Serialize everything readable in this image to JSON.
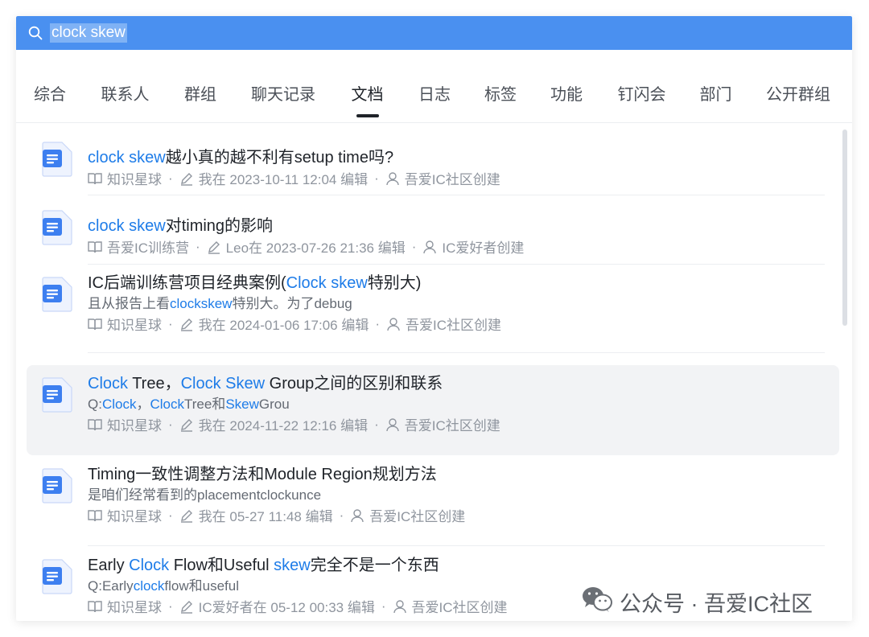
{
  "search": {
    "query": "clock skew"
  },
  "tabs": [
    "综合",
    "联系人",
    "群组",
    "聊天记录",
    "文档",
    "日志",
    "标签",
    "功能",
    "钉闪会",
    "部门",
    "公开群组"
  ],
  "active_tab": "文档",
  "results": [
    {
      "title_parts": [
        [
          "hl",
          "clock skew"
        ],
        [
          "t",
          "越小真的越不利有setup time吗?"
        ]
      ],
      "snippet_parts": [],
      "space": "知识星球",
      "editor": "我在 2023-10-11 12:04 编辑",
      "creator": "吾爱IC社区创建"
    },
    {
      "title_parts": [
        [
          "hl",
          "clock skew"
        ],
        [
          "t",
          "对timing的影响"
        ]
      ],
      "snippet_parts": [],
      "space": "吾爱IC训练营",
      "editor": "Leo在 2023-07-26 21:36 编辑",
      "creator": "IC爱好者创建"
    },
    {
      "title_parts": [
        [
          "t",
          "IC后端训练营项目经典案例("
        ],
        [
          "hl",
          "Clock skew"
        ],
        [
          "t",
          "特别大)"
        ]
      ],
      "snippet_parts": [
        [
          "t",
          "且从报告上看"
        ],
        [
          "hl",
          "clockskew"
        ],
        [
          "t",
          "特别大。为了debug"
        ]
      ],
      "space": "知识星球",
      "editor": "我在 2024-01-06 17:06 编辑",
      "creator": "吾爱IC社区创建"
    },
    {
      "title_parts": [
        [
          "hl",
          "Clock"
        ],
        [
          "t",
          " Tree，"
        ],
        [
          "hl",
          "Clock Skew"
        ],
        [
          "t",
          " Group之间的区别和联系"
        ]
      ],
      "snippet_parts": [
        [
          "t",
          "Q:"
        ],
        [
          "hl",
          "Clock"
        ],
        [
          "t",
          "，"
        ],
        [
          "hl",
          "Clock"
        ],
        [
          "t",
          "Tree和"
        ],
        [
          "hl",
          "Skew"
        ],
        [
          "t",
          "Grou"
        ]
      ],
      "space": "知识星球",
      "editor": "我在 2024-11-22 12:16 编辑",
      "creator": "吾爱IC社区创建"
    },
    {
      "title_parts": [
        [
          "t",
          "Timing一致性调整方法和Module Region规划方法"
        ]
      ],
      "snippet_parts": [
        [
          "t",
          "是咱们经常看到的placementclockunce"
        ]
      ],
      "space": "知识星球",
      "editor": "我在 05-27 11:48 编辑",
      "creator": "吾爱IC社区创建"
    },
    {
      "title_parts": [
        [
          "t",
          "Early "
        ],
        [
          "hl",
          "Clock"
        ],
        [
          "t",
          " Flow和Useful "
        ],
        [
          "hl",
          "skew"
        ],
        [
          "t",
          "完全不是一个东西"
        ]
      ],
      "snippet_parts": [
        [
          "t",
          "Q:Early"
        ],
        [
          "hl",
          "clock"
        ],
        [
          "t",
          "flow和useful"
        ]
      ],
      "space": "知识星球",
      "editor": "IC爱好者在 05-12 00:33 编辑",
      "creator": "吾爱IC社区创建"
    }
  ],
  "meta_separator": "·",
  "watermark": {
    "text": "公众号 · 吾爱IC社区"
  },
  "colors": {
    "search_bg": "#4a90f0",
    "highlight": "#1e7ce8",
    "doc_icon": "#3d7ff0"
  },
  "icons": [
    "search-icon",
    "document-icon",
    "book-icon",
    "edit-icon",
    "user-icon",
    "wechat-icon"
  ]
}
